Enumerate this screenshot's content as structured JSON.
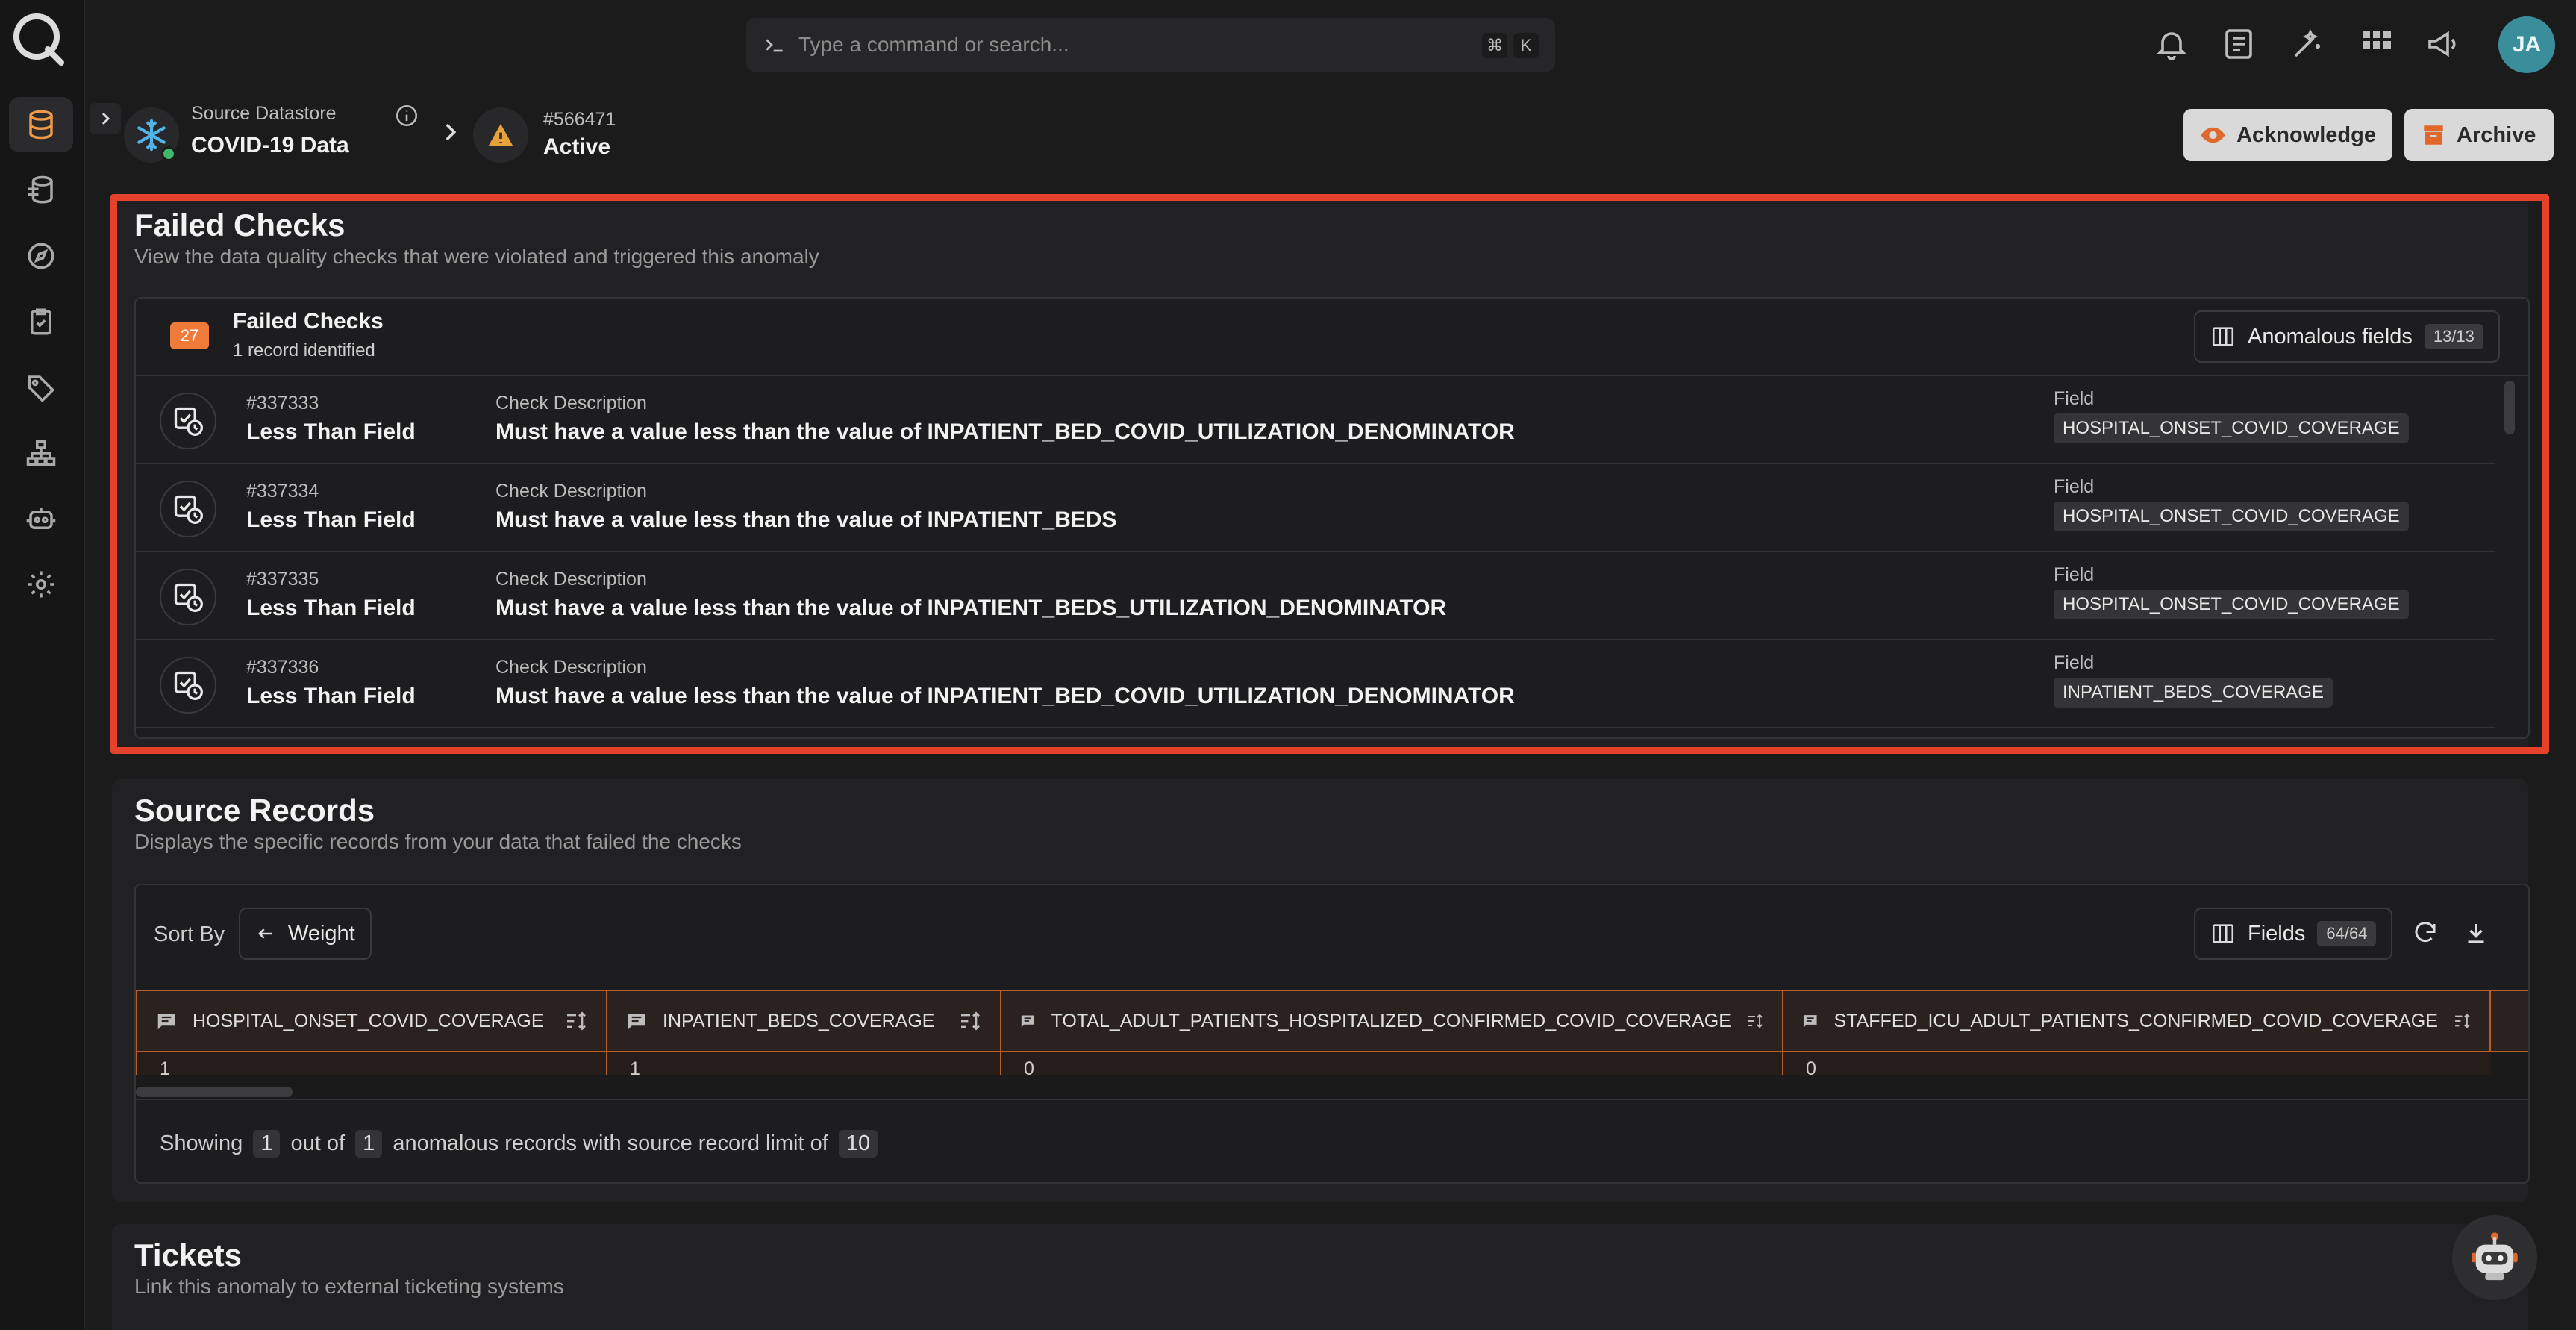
{
  "search": {
    "placeholder": "Type a command or search...",
    "kbd1": "⌘",
    "kbd2": "K"
  },
  "user": {
    "initials": "JA"
  },
  "header": {
    "datastore_label": "Source Datastore",
    "datastore_name": "COVID-19 Data",
    "anomaly_id": "#566471",
    "anomaly_status": "Active",
    "acknowledge_label": "Acknowledge",
    "archive_label": "Archive"
  },
  "failed_checks": {
    "title": "Failed Checks",
    "subtitle": "View the data quality checks that were violated and triggered this anomaly",
    "count_badge": "27",
    "list_title": "Failed Checks",
    "list_sub": "1 record identified",
    "anomalous_fields_label": "Anomalous fields",
    "anomalous_fields_count": "13/13",
    "rows": [
      {
        "id": "#337333",
        "name": "Less Than Field",
        "desc_label": "Check Description",
        "desc": "Must have a value less than the value of INPATIENT_BED_COVID_UTILIZATION_DENOMINATOR",
        "field_label": "Field",
        "field": "HOSPITAL_ONSET_COVID_COVERAGE"
      },
      {
        "id": "#337334",
        "name": "Less Than Field",
        "desc_label": "Check Description",
        "desc": "Must have a value less than the value of INPATIENT_BEDS",
        "field_label": "Field",
        "field": "HOSPITAL_ONSET_COVID_COVERAGE"
      },
      {
        "id": "#337335",
        "name": "Less Than Field",
        "desc_label": "Check Description",
        "desc": "Must have a value less than the value of INPATIENT_BEDS_UTILIZATION_DENOMINATOR",
        "field_label": "Field",
        "field": "HOSPITAL_ONSET_COVID_COVERAGE"
      },
      {
        "id": "#337336",
        "name": "Less Than Field",
        "desc_label": "Check Description",
        "desc": "Must have a value less than the value of INPATIENT_BED_COVID_UTILIZATION_DENOMINATOR",
        "field_label": "Field",
        "field": "INPATIENT_BEDS_COVERAGE"
      }
    ]
  },
  "source_records": {
    "title": "Source Records",
    "subtitle": "Displays the specific records from your data that failed the checks",
    "sort_label": "Sort By",
    "sort_value": "Weight",
    "fields_label": "Fields",
    "fields_count": "64/64",
    "columns": [
      {
        "name": "HOSPITAL_ONSET_COVID_COVERAGE",
        "value": "1"
      },
      {
        "name": "INPATIENT_BEDS_COVERAGE",
        "value": "1"
      },
      {
        "name": "TOTAL_ADULT_PATIENTS_HOSPITALIZED_CONFIRMED_COVID_COVERAGE",
        "value": "0"
      },
      {
        "name": "STAFFED_ICU_ADULT_PATIENTS_CONFIRMED_COVID_COVERAGE",
        "value": "0"
      }
    ],
    "footer": {
      "showing": "Showing",
      "shown": "1",
      "out_of": "out of",
      "total": "1",
      "suffix": "anomalous records with source record limit of",
      "limit": "10"
    }
  },
  "tickets": {
    "title": "Tickets",
    "subtitle": "Link this anomaly to external ticketing systems"
  },
  "colors": {
    "accent": "#ef7a3a",
    "highlight": "#e5422b",
    "avatar": "#3a8e9c",
    "online": "#3fb86b"
  }
}
